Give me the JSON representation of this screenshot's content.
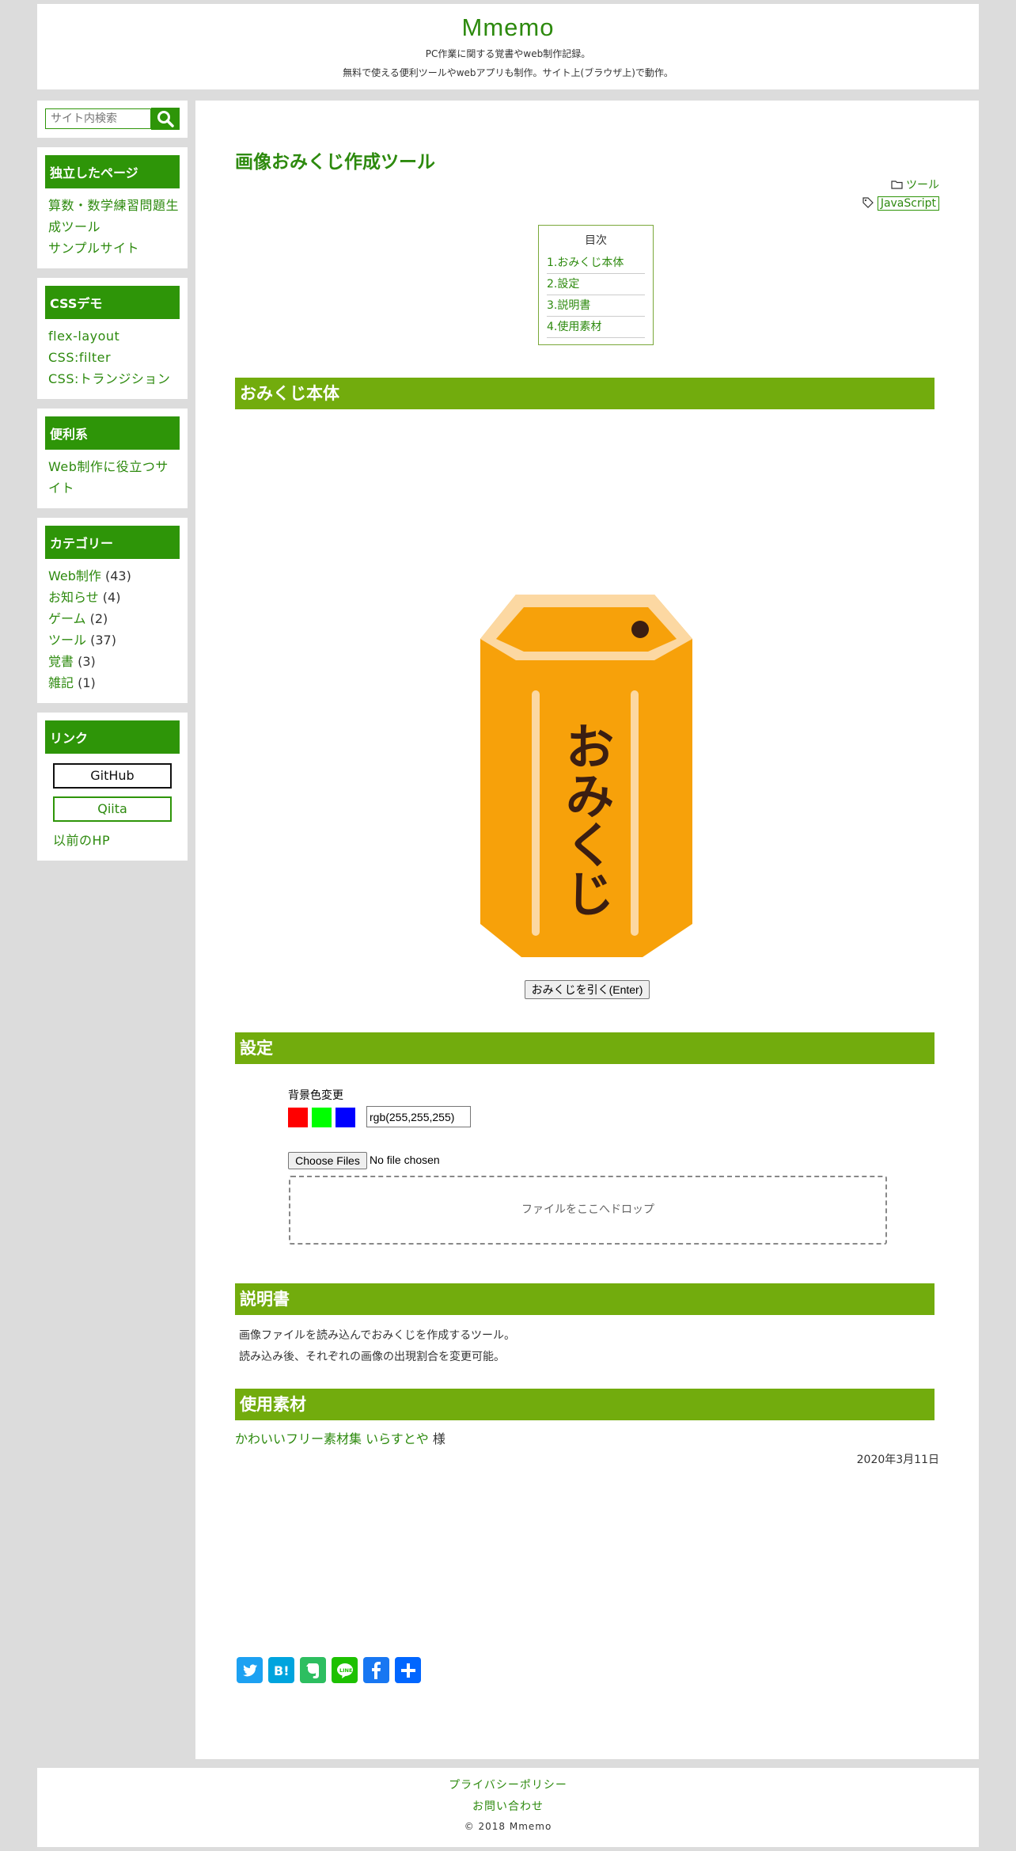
{
  "header": {
    "site_title": "Mmemo",
    "tagline_1": "PC作業に関する覚書やweb制作記録。",
    "tagline_2": "無料で使える便利ツールやwebアプリも制作。サイト上(ブラウザ上)で動作。"
  },
  "sidebar": {
    "search": {
      "placeholder": "サイト内検索",
      "icon": "search-icon"
    },
    "pages": {
      "title": "独立したページ",
      "items": [
        "算数・数学練習問題生成ツール",
        "サンプルサイト"
      ]
    },
    "css": {
      "title": "CSSデモ",
      "items": [
        "flex-layout",
        "CSS:filter",
        "CSS:トランジション"
      ]
    },
    "tools": {
      "title": "便利系",
      "items": [
        "Web制作に役立つサイト"
      ]
    },
    "categories": {
      "title": "カテゴリー",
      "items": [
        {
          "name": "Web制作",
          "count": "(43)"
        },
        {
          "name": "お知らせ",
          "count": "(4)"
        },
        {
          "name": "ゲーム",
          "count": "(2)"
        },
        {
          "name": "ツール",
          "count": "(37)"
        },
        {
          "name": "覚書",
          "count": "(3)"
        },
        {
          "name": "雑記",
          "count": "(1)"
        }
      ]
    },
    "links": {
      "title": "リンク",
      "github": "GitHub",
      "qiita": "Qiita",
      "old_hp": "以前のHP"
    }
  },
  "post": {
    "title": "画像おみくじ作成ツール",
    "category": "ツール",
    "tag": "JavaScript",
    "toc": {
      "title": "目次",
      "items": [
        "1.おみくじ本体",
        "2.設定",
        "3.説明書",
        "4.使用素材"
      ]
    },
    "section1": {
      "heading": "おみくじ本体",
      "image_text": "おみくじ",
      "draw_button": "おみくじを引く(Enter)"
    },
    "section2": {
      "heading": "設定",
      "bg_label": "背景色変更",
      "swatches": [
        "#ff0000",
        "#00ff00",
        "#0000ff"
      ],
      "rgb_value": "rgb(255,255,255)",
      "file_button": "Choose Files",
      "file_status": "No file chosen",
      "dropzone": "ファイルをここへドロップ"
    },
    "section3": {
      "heading": "説明書",
      "line1": "画像ファイルを読み込んでおみくじを作成するツール。",
      "line2": "読み込み後、それぞれの画像の出現割合を変更可能。"
    },
    "section4": {
      "heading": "使用素材",
      "credit_link": "かわいいフリー素材集 いらすとや",
      "credit_suffix": " 様"
    },
    "date": "2020年3月11日",
    "share": [
      "twitter-icon",
      "hatena-icon",
      "evernote-icon",
      "line-icon",
      "facebook-icon",
      "share-plus-icon"
    ]
  },
  "footer": {
    "privacy": "プライバシーポリシー",
    "contact": "お問い合わせ",
    "copyright": "© 2018 Mmemo"
  },
  "colors": {
    "brand_green": "#2e9508",
    "heading_green": "#72ac0d",
    "omikuji_orange": "#f7a10a"
  }
}
